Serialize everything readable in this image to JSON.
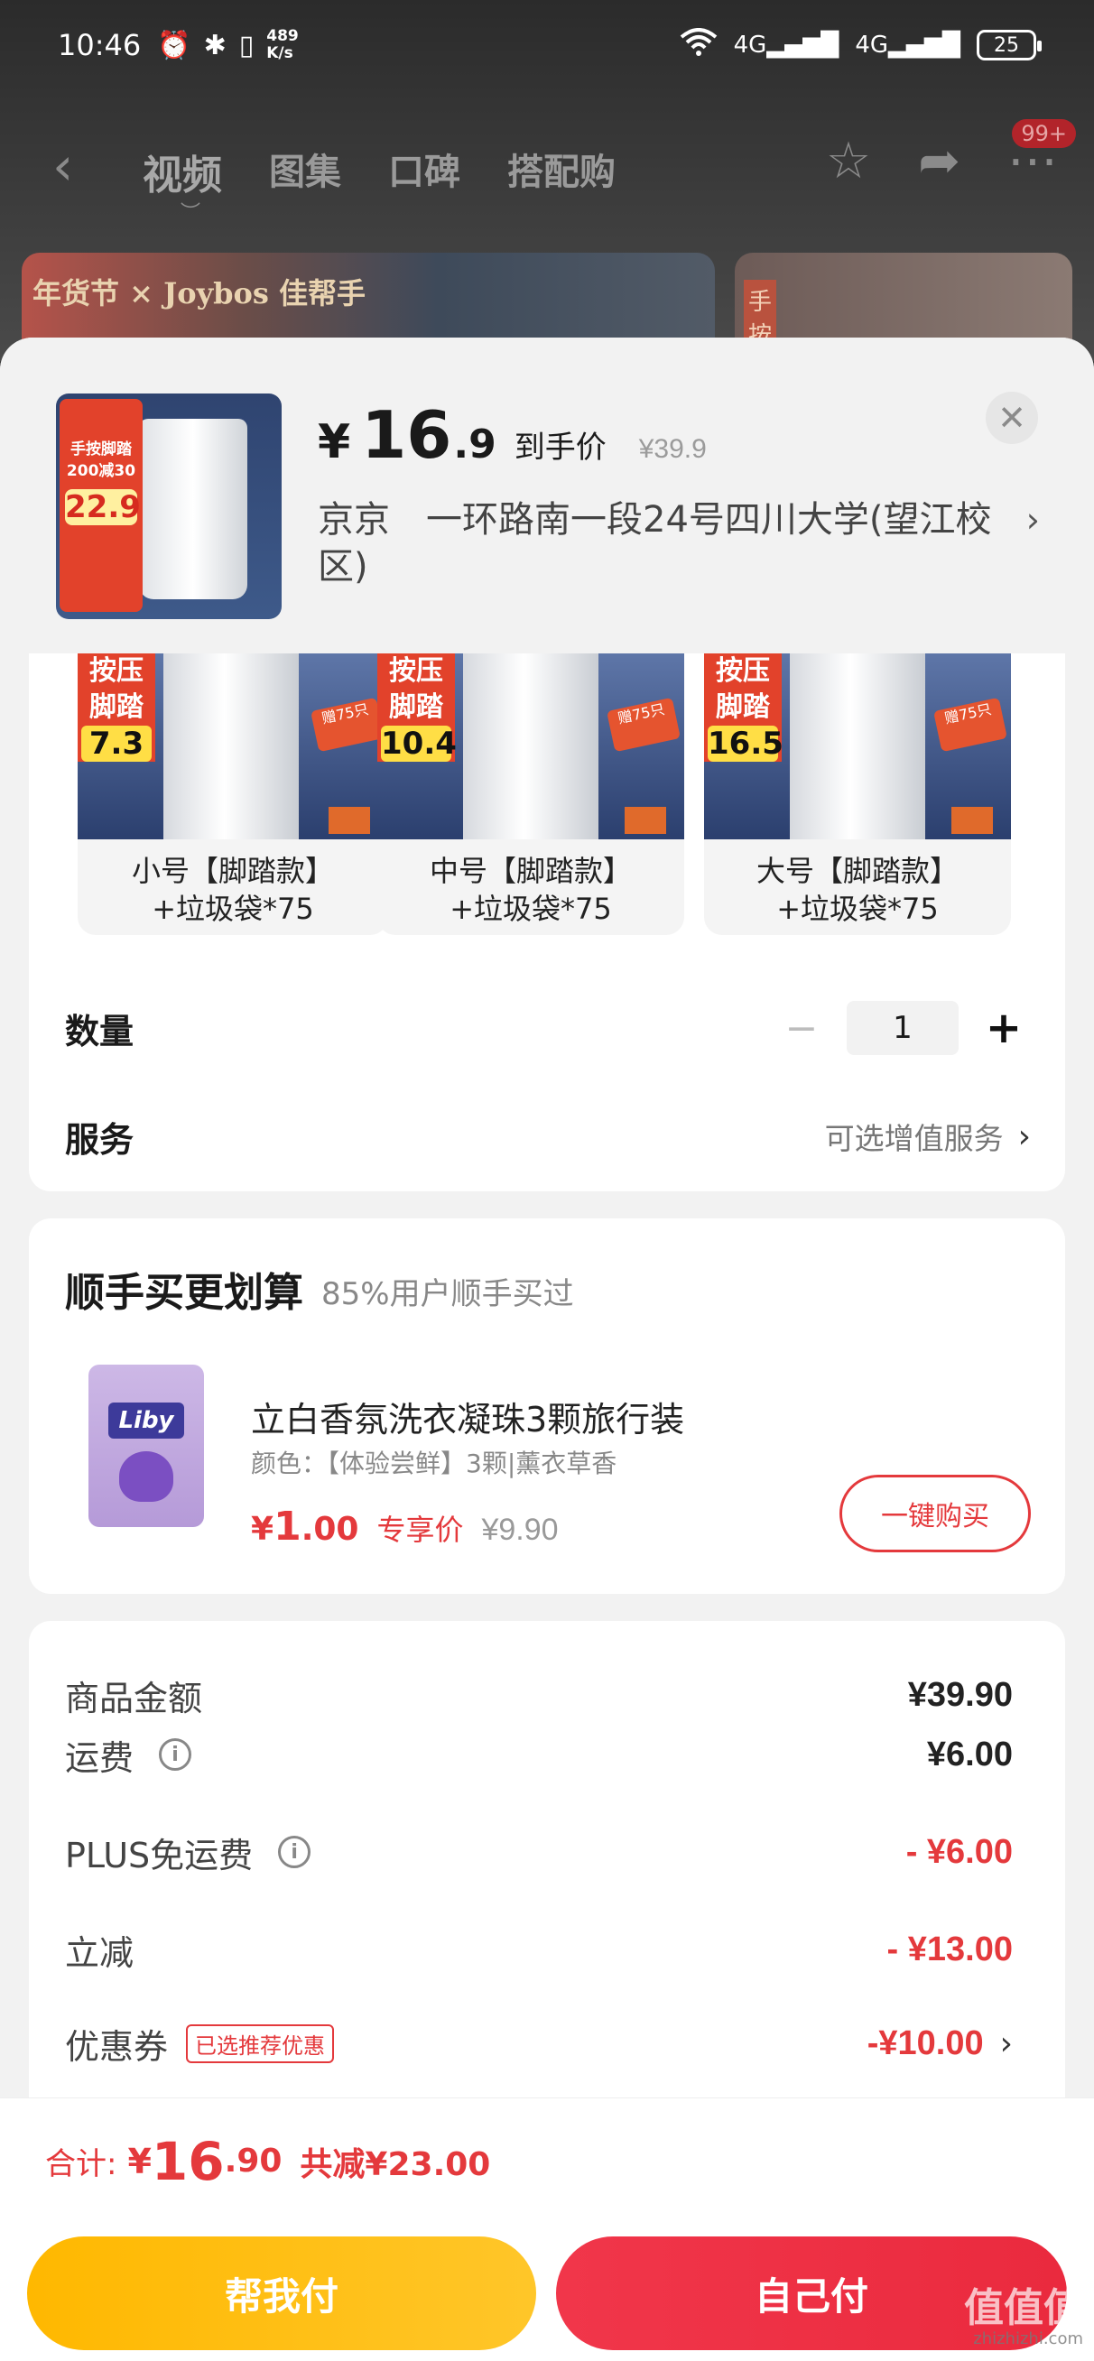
{
  "status_bar": {
    "time": "10:46",
    "net_speed": "489\nK/s",
    "net_speed_top": "489",
    "net_speed_bottom": "K/s",
    "signal1": "4G",
    "signal2": "4G",
    "battery": "25"
  },
  "nav": {
    "back_icon": "chevron-left",
    "tabs": [
      "视频",
      "图集",
      "口碑",
      "搭配购"
    ],
    "badge": "99+"
  },
  "banner": {
    "left_label": "年货节 × Joybos 佳帮手",
    "right_label": "手按"
  },
  "sheet": {
    "currency": "¥",
    "price_int": "16",
    "price_dec": ".9",
    "price_label": "到手价",
    "original_price": "¥39.9",
    "address": "京京　一环路南一段24号四川大学(望江校区)",
    "thumb_tag_top": "手按脚踏",
    "thumb_tag_mid": "200减30",
    "thumb_price": "22.9"
  },
  "skus": [
    {
      "name_line1": "小号【脚踏款】",
      "name_line2": "+垃圾袋*75",
      "vol": "7.3",
      "tag": "按压脚踏",
      "bag": "赠75只"
    },
    {
      "name_line1": "中号【脚踏款】",
      "name_line2": "+垃圾袋*75",
      "vol": "10.4",
      "tag": "按压脚踏",
      "bag": "赠75只"
    },
    {
      "name_line1": "大号【脚踏款】",
      "name_line2": "+垃圾袋*75",
      "vol": "16.5",
      "tag": "按压脚踏",
      "bag": "赠75只"
    }
  ],
  "quantity": {
    "label": "数量",
    "value": "1",
    "minus": "−",
    "plus": "+"
  },
  "service": {
    "label": "服务",
    "value": "可选增值服务"
  },
  "addon": {
    "title": "顺手买更划算",
    "subtitle": "85%用户顺手买过",
    "product_name": "立白香氛洗衣凝珠3颗旅行装",
    "spec": "颜色：【体验尝鲜】3颗|薰衣草香",
    "logo": "Liby",
    "price_cur": "¥",
    "price_int": "1",
    "price_dec": ".00",
    "price_label": "专享价",
    "orig_price": "¥9.90",
    "buy_label": "一键购买"
  },
  "amount_rows": [
    {
      "label": "商品金额",
      "value": "¥39.90"
    },
    {
      "label": "运费",
      "value": "¥6.00"
    },
    {
      "label": "PLUS免运费",
      "value": "- ¥6.00"
    },
    {
      "label": "立减",
      "value": "- ¥13.00"
    },
    {
      "label": "优惠券",
      "chip": "已选推荐优惠",
      "value": "-¥10.00"
    }
  ],
  "total": {
    "label": "合计:",
    "currency": "¥",
    "int": "16",
    "dec": ".90",
    "saving": "共减¥23.00"
  },
  "buttons": {
    "help_pay": "帮我付",
    "self_pay": "自己付"
  },
  "watermark": {
    "main": "值值值",
    "sub": "zhizhizhi.com"
  },
  "colors": {
    "accent_red": "#e4393c",
    "help_yellow": "#ffb800",
    "self_red": "#ea2a3e"
  }
}
